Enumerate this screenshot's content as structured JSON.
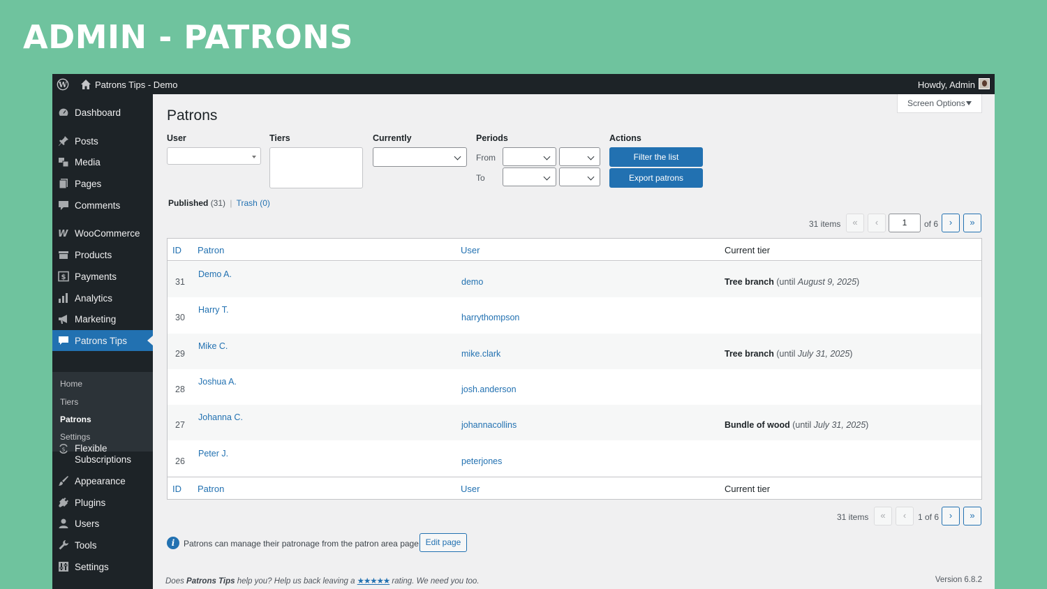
{
  "banner": {
    "title": "Admin - Patrons"
  },
  "adminbar": {
    "site_name": "Patrons Tips - Demo",
    "greeting": "Howdy, Admin"
  },
  "sidebar": {
    "items": [
      {
        "label": "Dashboard",
        "icon": "dashboard-icon"
      },
      {
        "label": "Posts",
        "icon": "pin-icon"
      },
      {
        "label": "Media",
        "icon": "media-icon"
      },
      {
        "label": "Pages",
        "icon": "pages-icon"
      },
      {
        "label": "Comments",
        "icon": "comment-icon"
      },
      {
        "label": "WooCommerce",
        "icon": "woocommerce-icon"
      },
      {
        "label": "Products",
        "icon": "archive-icon"
      },
      {
        "label": "Payments",
        "icon": "dollar-icon"
      },
      {
        "label": "Analytics",
        "icon": "bar-chart-icon"
      },
      {
        "label": "Marketing",
        "icon": "megaphone-icon"
      },
      {
        "label": "Patrons Tips",
        "icon": "chat-icon"
      },
      {
        "label": "Flexible",
        "label2": "Subscriptions",
        "icon": "subscriptions-icon"
      },
      {
        "label": "Appearance",
        "icon": "brush-icon"
      },
      {
        "label": "Plugins",
        "icon": "plug-icon"
      },
      {
        "label": "Users",
        "icon": "users-icon"
      },
      {
        "label": "Tools",
        "icon": "wrench-icon"
      },
      {
        "label": "Settings",
        "icon": "settings-icon"
      }
    ],
    "submenu": [
      "Home",
      "Tiers",
      "Patrons",
      "Settings"
    ]
  },
  "screen_options": "Screen Options",
  "page_title": "Patrons",
  "filters": {
    "user_label": "User",
    "tiers_label": "Tiers",
    "currently_label": "Currently",
    "periods_label": "Periods",
    "from_label": "From",
    "to_label": "To",
    "actions_label": "Actions",
    "filter_button": "Filter the list",
    "export_button": "Export patrons"
  },
  "views": {
    "published": "Published",
    "published_count": "(31)",
    "separator": "|",
    "trash": "Trash",
    "trash_count": "(0)"
  },
  "pagination_top": {
    "items": "31 items",
    "first": "«",
    "prev": "‹",
    "page": "1",
    "of": "of 6",
    "next": "›",
    "last": "»"
  },
  "pagination_bottom": {
    "items": "31 items",
    "first": "«",
    "prev": "‹",
    "page_text": "1 of 6",
    "next": "›",
    "last": "»"
  },
  "table": {
    "columns": [
      "ID",
      "Patron",
      "User",
      "Current tier"
    ],
    "rows": [
      {
        "id": "31",
        "patron": "Demo A.",
        "user": "demo",
        "tier": "Tree branch",
        "tier_pre": " (until ",
        "tier_date": "August 9, 2025",
        "tier_post": ")"
      },
      {
        "id": "30",
        "patron": "Harry T.",
        "user": "harrythompson",
        "tier": "",
        "tier_pre": "",
        "tier_date": "",
        "tier_post": ""
      },
      {
        "id": "29",
        "patron": "Mike C.",
        "user": "mike.clark",
        "tier": "Tree branch",
        "tier_pre": " (until ",
        "tier_date": "July 31, 2025",
        "tier_post": ")"
      },
      {
        "id": "28",
        "patron": "Joshua A.",
        "user": "josh.anderson",
        "tier": "",
        "tier_pre": "",
        "tier_date": "",
        "tier_post": ""
      },
      {
        "id": "27",
        "patron": "Johanna C.",
        "user": "johannacollins",
        "tier": "Bundle of wood",
        "tier_pre": " (until ",
        "tier_date": "July 31, 2025",
        "tier_post": ")"
      },
      {
        "id": "26",
        "patron": "Peter J.",
        "user": "peterjones",
        "tier": "",
        "tier_pre": "",
        "tier_date": "",
        "tier_post": ""
      }
    ]
  },
  "notice": {
    "text": "Patrons can manage their patronage from the patron area page.",
    "button": "Edit page"
  },
  "footer": {
    "prefix": "Does ",
    "plugin": "Patrons Tips",
    "middle": " help you? Help us back leaving a ",
    "stars": "★★★★★",
    "suffix": " rating. We need you too.",
    "version": "Version 6.8.2"
  },
  "colors": {
    "background": "#6fc39e",
    "admin_dark": "#1d2327",
    "accent": "#2271b1"
  }
}
